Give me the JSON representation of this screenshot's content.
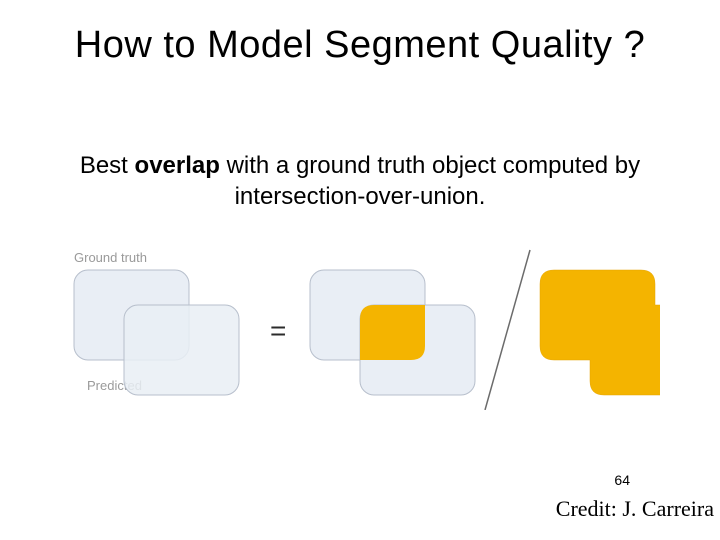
{
  "title": "How to Model Segment Quality ?",
  "body": {
    "prefix": "Best ",
    "emph": "overlap",
    "suffix": " with a ground truth object computed by intersection-over-union."
  },
  "labels": {
    "ground_truth": "Ground truth",
    "predicted": "Predicted"
  },
  "colors": {
    "box_fill": "#e9eef5",
    "box_stroke": "#b7bfcc",
    "highlight": "#f4b400",
    "label": "#9a9a9a"
  },
  "page_number": "64",
  "credit": "Credit: J. Carreira"
}
